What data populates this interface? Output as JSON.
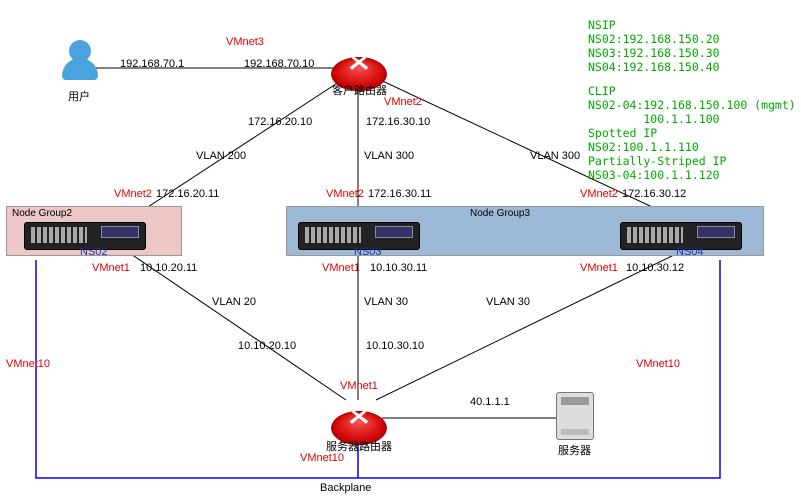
{
  "vmnets": {
    "n3_left": "VMnet3",
    "n2_router_right": "VMnet2",
    "n2_ns02": "VMnet2",
    "n2_ns03": "VMnet2",
    "n2_ns04": "VMnet2",
    "n1_ns02": "VMnet1",
    "n1_ns03": "VMnet1",
    "n1_ns04": "VMnet1",
    "n1_srv_router": "VMnet1",
    "n10_left": "VMnet10",
    "n10_right": "VMnet10",
    "n10_srv_router": "VMnet10"
  },
  "ips": {
    "user_side": "192.168.70.1",
    "client_router_user": "192.168.70.10",
    "client_router_v200": "172.16.20.10",
    "client_router_v300mid": "172.16.30.10",
    "ns02_up": "172.16.20.11",
    "ns03_up": "172.16.30.11",
    "ns04_up": "172.16.30.12",
    "ns02_down": "10.10.20.11",
    "ns03_down": "10.10.30.11",
    "ns04_down": "10.10.30.12",
    "srv_router_v20": "10.10.20.10",
    "srv_router_v30": "10.10.30.10",
    "server_ip": "40.1.1.1"
  },
  "vlans": {
    "v200": "VLAN 200",
    "v300a": "VLAN 300",
    "v300b": "VLAN 300",
    "v20": "VLAN 20",
    "v30a": "VLAN 30",
    "v30b": "VLAN 30"
  },
  "labels": {
    "user": "用户",
    "client_router": "客户路由器",
    "server_router": "服务器路由器",
    "server": "服务器",
    "backplane": "Backplane",
    "node_group2": "Node Group2",
    "node_group3": "Node Group3",
    "ns02": "NS02",
    "ns03": "NS03",
    "ns04": "NS04"
  },
  "info": {
    "nsip_hdr": "NSIP",
    "ns02": "NS02:192.168.150.20",
    "ns03": "NS03:192.168.150.30",
    "ns04": "NS04:192.168.150.40",
    "clip_hdr": "CLIP",
    "clip_n": "NS02-04:192.168.150.100 (mgmt)",
    "clip_v": "        100.1.1.100",
    "spotted_hdr": "Spotted IP",
    "spotted_v": "NS02:100.1.1.110",
    "ps_hdr": "Partially-Striped IP",
    "ps_v": "NS03-04:100.1.1.120"
  }
}
